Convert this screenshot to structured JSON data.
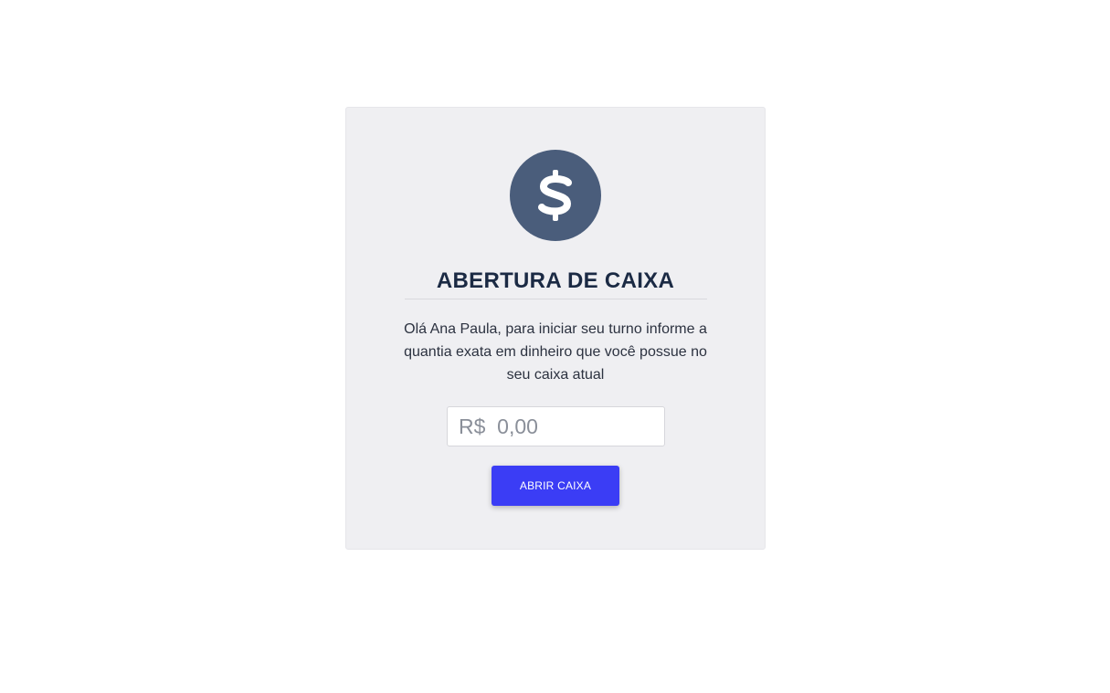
{
  "cash_opening": {
    "icon": "dollar-icon",
    "title": "ABERTURA DE CAIXA",
    "message": "Olá Ana Paula, para iniciar seu turno informe a quantia exata em dinheiro que você possue no seu caixa atual",
    "amount_input": {
      "placeholder": "R$  0,00",
      "value": ""
    },
    "open_button_label": "ABRIR CAIXA"
  },
  "colors": {
    "card_background": "#efeff2",
    "icon_circle": "#4a5d7b",
    "title_text": "#1b2a44",
    "button_background": "#3b3df5",
    "button_text": "#ffffff"
  }
}
